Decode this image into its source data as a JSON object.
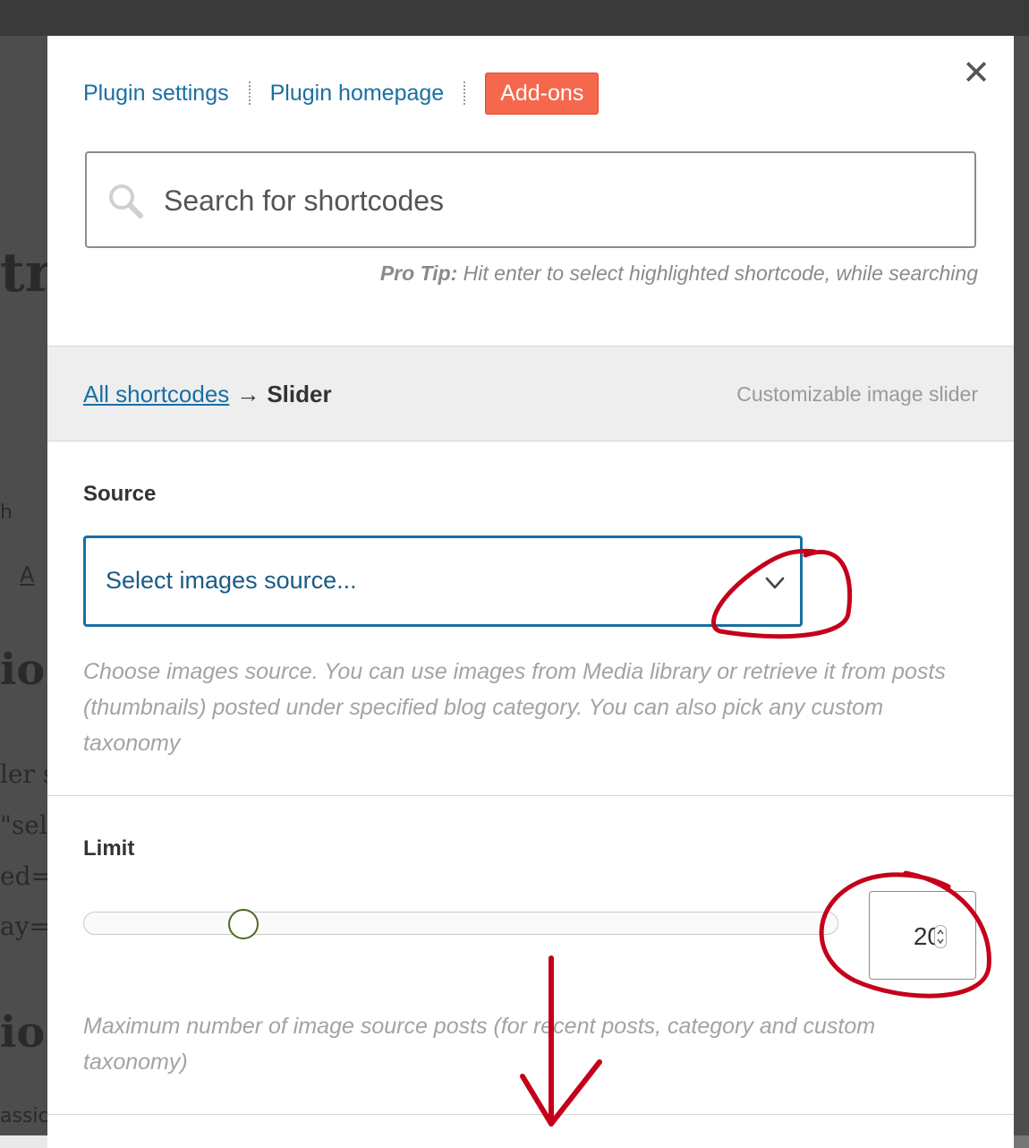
{
  "background": {
    "fragments": [
      "tr",
      "h",
      "A",
      "io",
      "ler s",
      "\"sel",
      "ed=\"",
      "ay=\"",
      "io",
      "assic"
    ]
  },
  "modal": {
    "nav": {
      "plugin_settings": "Plugin settings",
      "plugin_homepage": "Plugin homepage",
      "addons": "Add-ons"
    },
    "close_icon": "close-icon",
    "search": {
      "placeholder": "Search for shortcodes",
      "value": ""
    },
    "protip": {
      "label": "Pro Tip:",
      "text": " Hit enter to select highlighted shortcode, while searching"
    },
    "breadcrumb": {
      "root": "All shortcodes",
      "arrow": "→",
      "current": "Slider",
      "description": "Customizable image slider"
    },
    "source": {
      "label": "Source",
      "selected": "Select images source...",
      "help": "Choose images source. You can use images from Media library or retrieve it from posts (thumbnails) posted under specified blog category. You can also pick any custom taxonomy"
    },
    "limit": {
      "label": "Limit",
      "value": "20",
      "slider_fraction": 0.2,
      "help": "Maximum number of image source posts (for recent posts, category and custom taxonomy)"
    }
  },
  "colors": {
    "link": "#1a6fa3",
    "addons_bg": "#f5684e",
    "annotation": "#c4001a"
  }
}
